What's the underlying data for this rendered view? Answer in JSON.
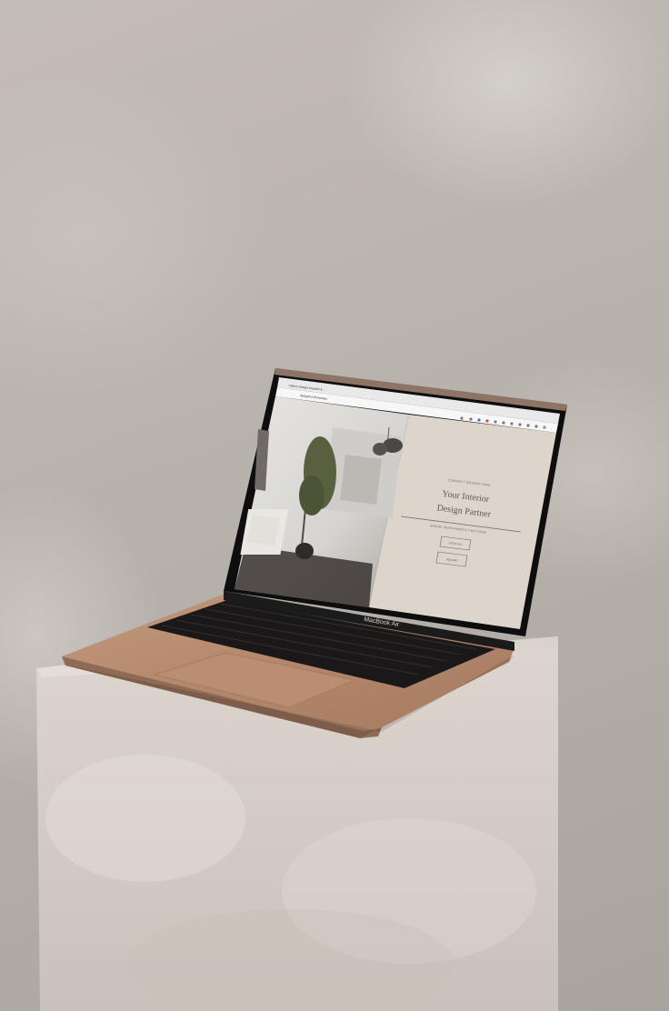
{
  "browser": {
    "tab_title": "Interior Design Inquiries & …",
    "url": "designfirm.flo/contact"
  },
  "website": {
    "eyebrow": "CONTACT DESIGN FIRM",
    "headline_line1": "Your Interior",
    "headline_line2": "Design Partner",
    "subtext": "WHERE INVESTMENTS FIND FORM",
    "button1": "BOOK US",
    "button2": "INQUIRE"
  },
  "laptop": {
    "brand_label": "MacBook Air"
  },
  "colors": {
    "wall": "#bbb5af",
    "pedestal": "#d8d2cb",
    "laptop_body": "#b3876b",
    "screen_panel": "#ddd5cb",
    "keyboard": "#141414"
  }
}
